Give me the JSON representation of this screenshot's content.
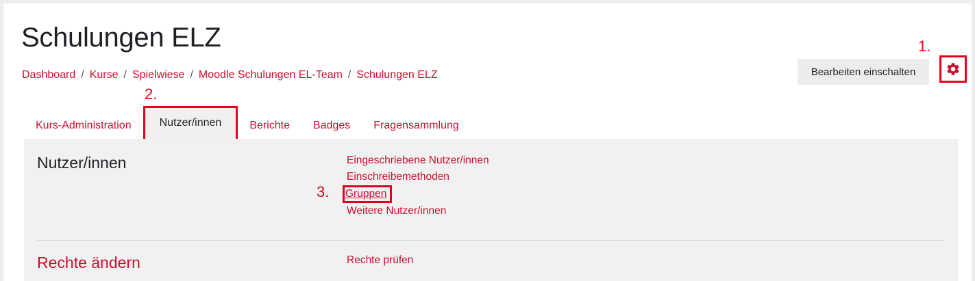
{
  "page": {
    "title": "Schulungen ELZ"
  },
  "breadcrumb": [
    "Dashboard",
    "Kurse",
    "Spielwiese",
    "Moodle Schulungen EL-Team",
    "Schulungen ELZ"
  ],
  "breadcrumb_separator": "/",
  "header": {
    "edit_button": "Bearbeiten einschalten",
    "settings_icon": "gear-icon"
  },
  "annotations": {
    "step1": "1.",
    "step2": "2.",
    "step3": "3."
  },
  "tabs": [
    {
      "label": "Kurs-Administration",
      "active": false
    },
    {
      "label": "Nutzer/innen",
      "active": true
    },
    {
      "label": "Berichte",
      "active": false
    },
    {
      "label": "Badges",
      "active": false
    },
    {
      "label": "Fragensammlung",
      "active": false
    }
  ],
  "sections": [
    {
      "title": "Nutzer/innen",
      "links": [
        "Eingeschriebene Nutzer/innen",
        "Einschreibemethoden",
        "Gruppen",
        "Weitere Nutzer/innen"
      ]
    },
    {
      "title": "Rechte ändern",
      "links": [
        "Rechte prüfen"
      ]
    }
  ],
  "colors": {
    "accent": "#c8102e",
    "annotation": "#e5001b",
    "panel": "#f1f1f1"
  }
}
